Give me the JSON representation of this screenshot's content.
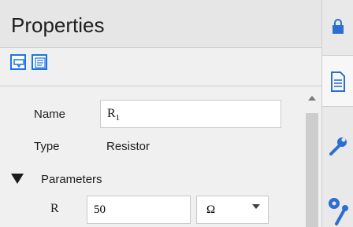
{
  "header": {
    "title": "Properties"
  },
  "toolbar": {
    "buttons": [
      {
        "icon": "component-view-icon"
      },
      {
        "icon": "text-view-icon"
      }
    ]
  },
  "properties": {
    "name": {
      "label": "Name",
      "value_base": "R",
      "value_sub": "1"
    },
    "type": {
      "label": "Type",
      "value": "Resistor"
    },
    "parameters": {
      "label": "Parameters",
      "rows": [
        {
          "name": "R",
          "value": "50",
          "unit": "Ω"
        }
      ]
    }
  },
  "right_sidebar": {
    "items": [
      {
        "icon": "lock-icon"
      },
      {
        "icon": "document-icon"
      },
      {
        "icon": "wrench-icon"
      },
      {
        "icon": "gear-wrench-icon"
      }
    ]
  }
}
